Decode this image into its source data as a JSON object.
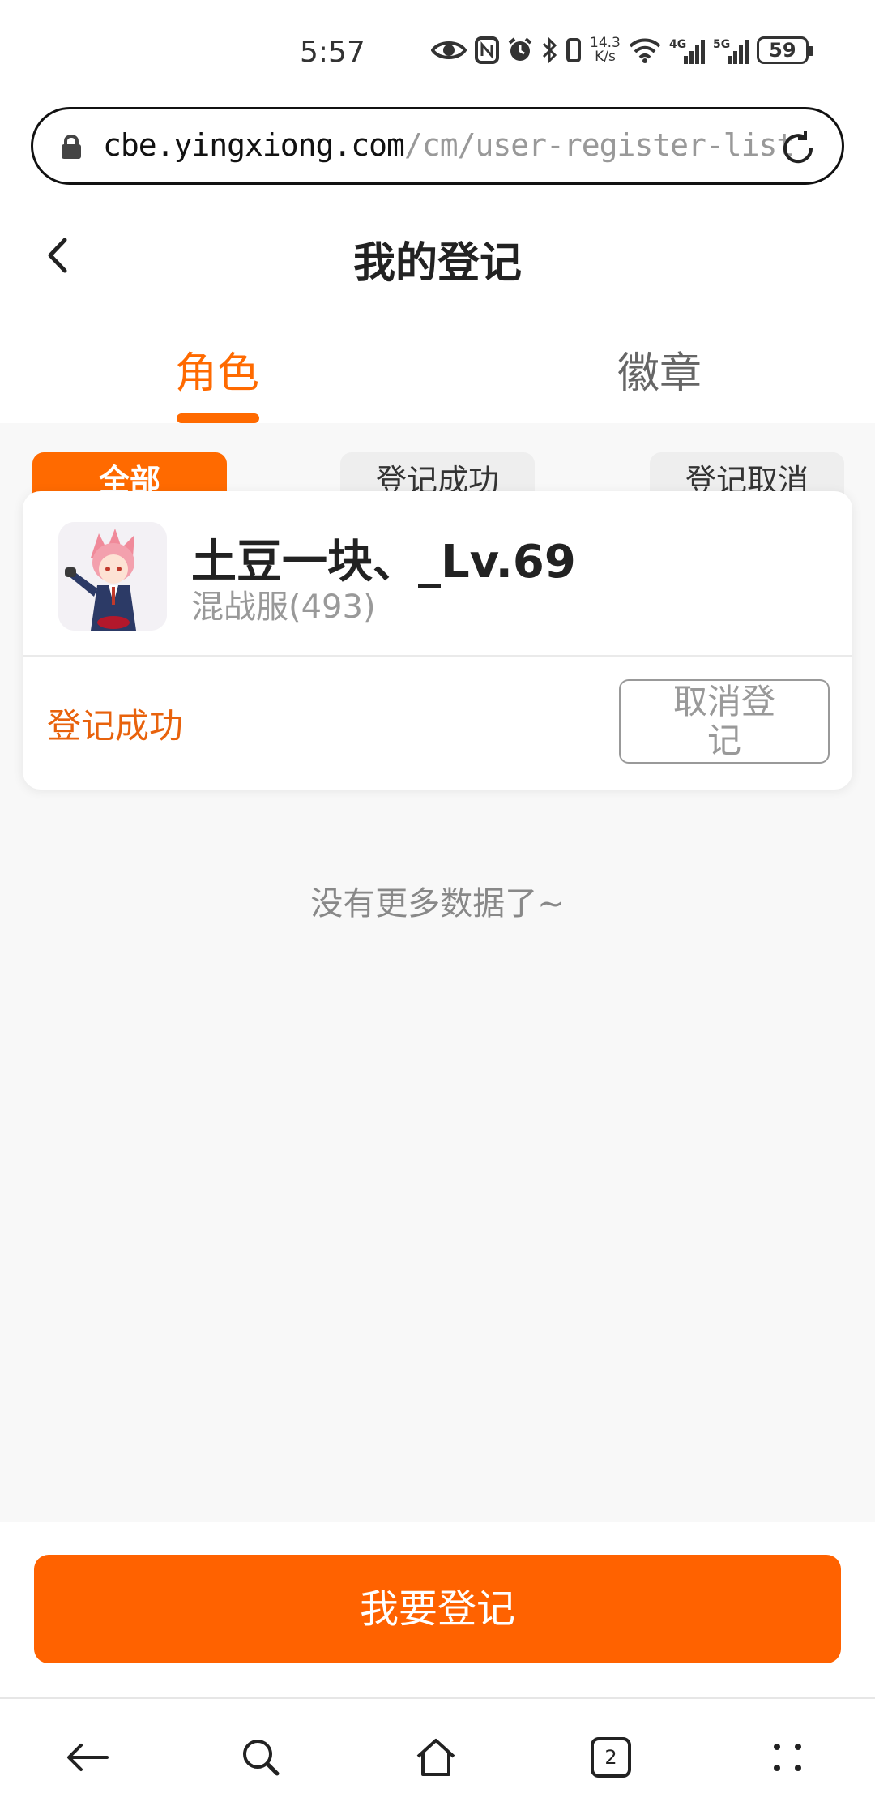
{
  "status_bar": {
    "time": "5:57",
    "net_speed_value": "14.3",
    "net_speed_unit": "K/s",
    "battery": "59",
    "icons": [
      "eye-icon",
      "nfc-icon",
      "alarm-icon",
      "bluetooth-icon",
      "vibrate-icon",
      "wifi-icon",
      "signal-4g-icon",
      "signal-5g-icon",
      "battery-icon"
    ]
  },
  "browser": {
    "url_host": "cbe.yingxiong.com",
    "url_path": "/cm/user-register-list",
    "nav": {
      "tabs_count": "2",
      "icons": [
        "back-arrow-icon",
        "search-icon",
        "home-icon",
        "tabs-icon",
        "more-dots-icon"
      ]
    }
  },
  "header": {
    "title": "我的登记"
  },
  "tabs": [
    {
      "label": "角色",
      "active": true
    },
    {
      "label": "徽章",
      "active": false
    }
  ],
  "filters": [
    {
      "label": "全部",
      "active": true
    },
    {
      "label": "登记成功",
      "active": false
    },
    {
      "label": "登记取消",
      "active": false
    }
  ],
  "card": {
    "character_name": "土豆一块、_Lv.69",
    "server": "混战服(493)",
    "status": "登记成功",
    "cancel_label": "取消登记"
  },
  "list_footer": "没有更多数据了~",
  "cta_label": "我要登记",
  "colors": {
    "accent": "#ff6a00",
    "cta": "#ff6200",
    "status_text": "#e8620c"
  }
}
